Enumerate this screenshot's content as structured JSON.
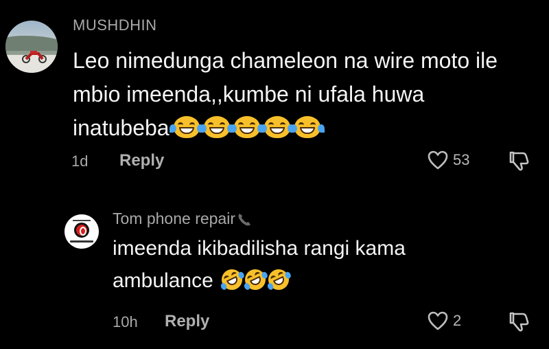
{
  "comments": [
    {
      "username": "MUSHDHIN",
      "text": "Leo nimedunga chameleon na wire moto ile mbio imeenda,,kumbe ni ufala huwa inatubeba",
      "emojis": [
        "face-with-tears-of-joy-icon",
        "face-with-tears-of-joy-icon",
        "face-with-tears-of-joy-icon",
        "face-with-tears-of-joy-icon",
        "face-with-tears-of-joy-icon"
      ],
      "time": "1d",
      "reply_label": "Reply",
      "likes": "53",
      "avatar": "motorcycle-photo-avatar"
    },
    {
      "username": "Tom phone repair",
      "username_icon": "telephone-receiver-icon",
      "text": "imeenda ikibadilisha rangi kama ambulance",
      "emojis": [
        "rolling-on-floor-laughing-icon",
        "rolling-on-floor-laughing-icon",
        "rolling-on-floor-laughing-icon"
      ],
      "time": "10h",
      "reply_label": "Reply",
      "likes": "2",
      "avatar": "red-logo-avatar"
    }
  ],
  "colors": {
    "background": "#000000",
    "text": "#f4f4f4",
    "muted": "#a9a9a9",
    "emoji_yellow": "#f7c02a",
    "tear_blue": "#4aa3f0"
  }
}
